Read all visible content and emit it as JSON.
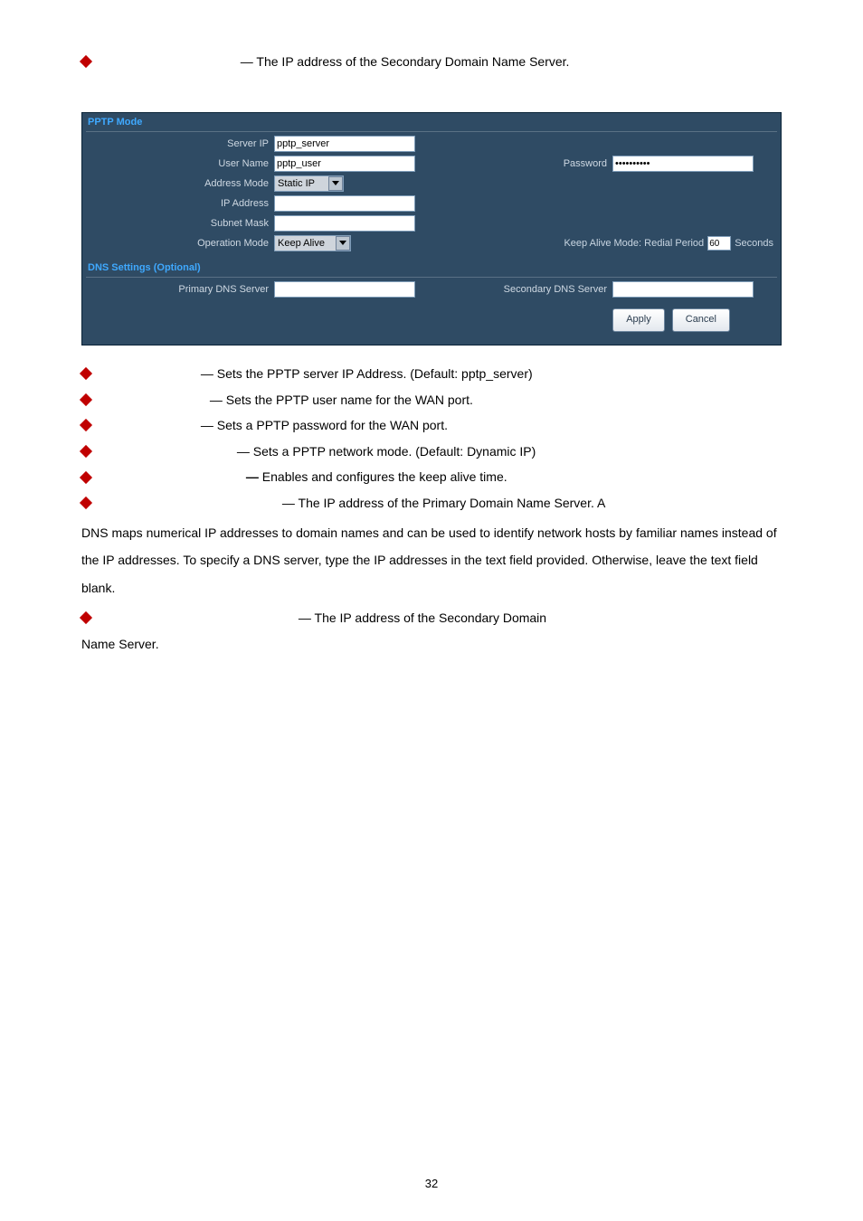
{
  "top_note": "— The IP address of the Secondary Domain Name Server.",
  "panel": {
    "title": "PPTP Mode",
    "server_ip_label": "Server IP",
    "server_ip_value": "pptp_server",
    "user_name_label": "User Name",
    "user_name_value": "pptp_user",
    "password_label": "Password",
    "password_value": "••••••••••",
    "address_mode_label": "Address Mode",
    "address_mode_value": "Static IP",
    "ip_address_label": "IP Address",
    "ip_address_value": "",
    "subnet_mask_label": "Subnet Mask",
    "subnet_mask_value": "",
    "operation_mode_label": "Operation Mode",
    "operation_mode_value": "Keep Alive",
    "redial_label_left": "Keep Alive Mode: Redial Period",
    "redial_value": "60",
    "redial_label_right": "Seconds",
    "dns_title": "DNS Settings (Optional)",
    "primary_dns_label": "Primary DNS Server",
    "secondary_dns_label": "Secondary DNS Server",
    "apply": "Apply",
    "cancel": "Cancel"
  },
  "bullets": {
    "b1": " — Sets the PPTP server IP Address. (Default: pptp_server)",
    "b2": " — Sets the PPTP user name for the WAN port.",
    "b3": " — Sets a PPTP password for the WAN port.",
    "b4": " — Sets a PPTP network mode. (Default: Dynamic IP)",
    "b5a": " — ",
    "b5b": "Enables and configures the keep alive time.",
    "b6": " — The IP address of the Primary Domain Name Server. A",
    "para": "DNS maps numerical IP addresses to domain names and can be used to identify network hosts by familiar names instead of the IP addresses. To specify a DNS server, type the IP addresses in the text field provided. Otherwise, leave the text field blank.",
    "b7": " — The IP address of the Secondary Domain",
    "tail": "Name Server."
  },
  "page_number": "32"
}
